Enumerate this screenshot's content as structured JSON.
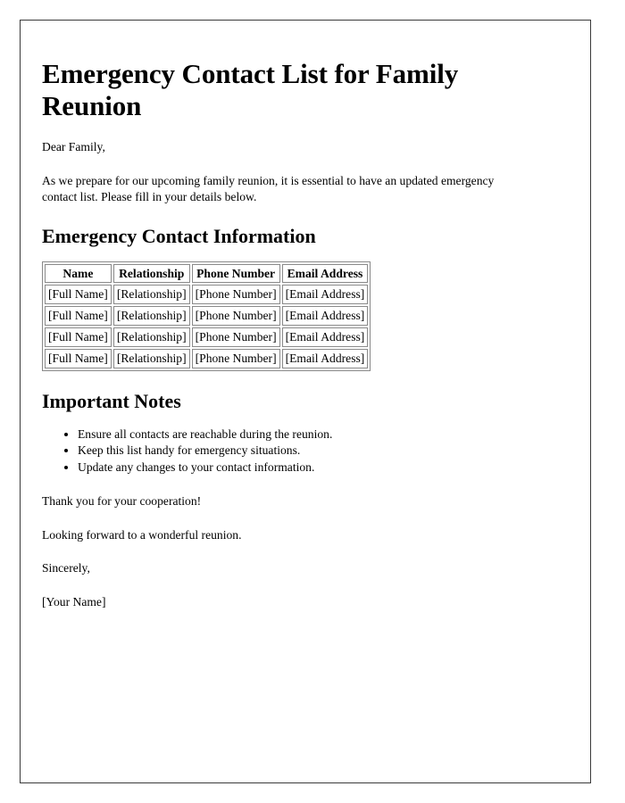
{
  "document": {
    "title": "Emergency Contact List for Family Reunion",
    "salutation": "Dear Family,",
    "intro": "As we prepare for our upcoming family reunion, it is essential to have an updated emergency contact list. Please fill in your details below.",
    "sections": {
      "contact_info": {
        "heading": "Emergency Contact Information",
        "table": {
          "columns": [
            "Name",
            "Relationship",
            "Phone Number",
            "Email Address"
          ],
          "rows": [
            [
              "[Full Name]",
              "[Relationship]",
              "[Phone Number]",
              "[Email Address]"
            ],
            [
              "[Full Name]",
              "[Relationship]",
              "[Phone Number]",
              "[Email Address]"
            ],
            [
              "[Full Name]",
              "[Relationship]",
              "[Phone Number]",
              "[Email Address]"
            ],
            [
              "[Full Name]",
              "[Relationship]",
              "[Phone Number]",
              "[Email Address]"
            ]
          ]
        }
      },
      "important_notes": {
        "heading": "Important Notes",
        "items": [
          "Ensure all contacts are reachable during the reunion.",
          "Keep this list handy for emergency situations.",
          "Update any changes to your contact information."
        ]
      }
    },
    "closing": {
      "thanks": "Thank you for your cooperation!",
      "forward": "Looking forward to a wonderful reunion.",
      "signoff": "Sincerely,",
      "signature": "[Your Name]"
    }
  },
  "colors": {
    "text": "#000000",
    "page_border": "#3a3a3a",
    "table_border": "#8a8a8a",
    "background": "#ffffff"
  }
}
